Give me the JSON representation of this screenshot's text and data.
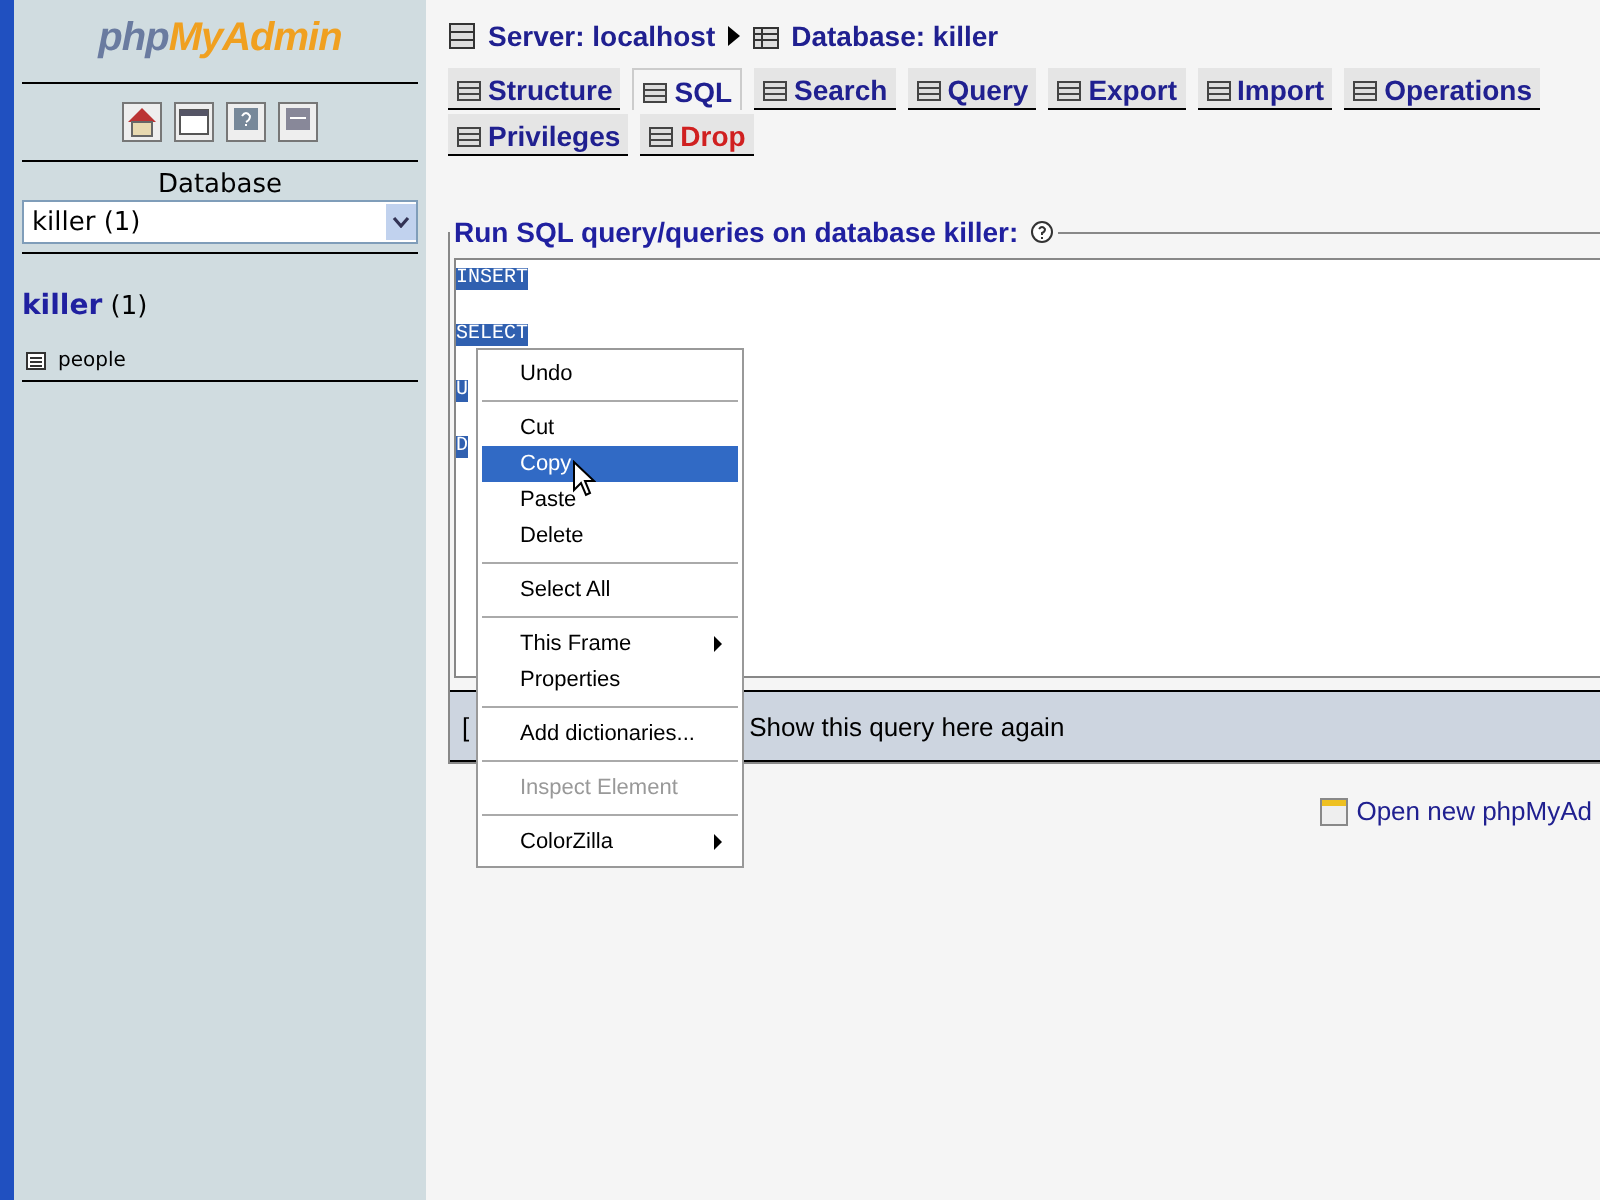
{
  "sidebar": {
    "logo_php": "php",
    "logo_rest": "MyAdmin",
    "database_label": "Database",
    "database_select": "killer (1)",
    "db_name": "killer",
    "db_count": "(1)",
    "tables": [
      {
        "name": "people"
      }
    ]
  },
  "breadcrumb": {
    "server": "Server: localhost",
    "database": "Database: killer"
  },
  "tabs": [
    {
      "label": "Structure",
      "selected": false,
      "kind": "normal"
    },
    {
      "label": "SQL",
      "selected": true,
      "kind": "normal"
    },
    {
      "label": "Search",
      "selected": false,
      "kind": "normal"
    },
    {
      "label": "Query",
      "selected": false,
      "kind": "normal"
    },
    {
      "label": "Export",
      "selected": false,
      "kind": "normal"
    },
    {
      "label": "Import",
      "selected": false,
      "kind": "normal"
    },
    {
      "label": "Operations",
      "selected": false,
      "kind": "normal"
    },
    {
      "label": "Privileges",
      "selected": false,
      "kind": "normal"
    },
    {
      "label": "Drop",
      "selected": false,
      "kind": "danger"
    }
  ],
  "sql_panel": {
    "legend": "Run SQL query/queries on database killer:",
    "lines": [
      "INSERT",
      "SELECT",
      "U",
      "D"
    ],
    "footer_bracket": "[",
    "show_again": "Show this query here again"
  },
  "open_new_link": "Open new phpMyAd",
  "context_menu": [
    {
      "kind": "item",
      "label": "Undo",
      "selected": false,
      "disabled": false,
      "submenu": false
    },
    {
      "kind": "separator"
    },
    {
      "kind": "item",
      "label": "Cut",
      "selected": false,
      "disabled": false,
      "submenu": false
    },
    {
      "kind": "item",
      "label": "Copy",
      "selected": true,
      "disabled": false,
      "submenu": false
    },
    {
      "kind": "item",
      "label": "Paste",
      "selected": false,
      "disabled": false,
      "submenu": false
    },
    {
      "kind": "item",
      "label": "Delete",
      "selected": false,
      "disabled": false,
      "submenu": false
    },
    {
      "kind": "separator"
    },
    {
      "kind": "item",
      "label": "Select All",
      "selected": false,
      "disabled": false,
      "submenu": false
    },
    {
      "kind": "separator"
    },
    {
      "kind": "item",
      "label": "This Frame",
      "selected": false,
      "disabled": false,
      "submenu": true
    },
    {
      "kind": "item",
      "label": "Properties",
      "selected": false,
      "disabled": false,
      "submenu": false
    },
    {
      "kind": "separator"
    },
    {
      "kind": "item",
      "label": "Add dictionaries...",
      "selected": false,
      "disabled": false,
      "submenu": false
    },
    {
      "kind": "separator"
    },
    {
      "kind": "item",
      "label": "Inspect Element",
      "selected": false,
      "disabled": true,
      "submenu": false
    },
    {
      "kind": "separator"
    },
    {
      "kind": "item",
      "label": "ColorZilla",
      "selected": false,
      "disabled": false,
      "submenu": true
    }
  ]
}
